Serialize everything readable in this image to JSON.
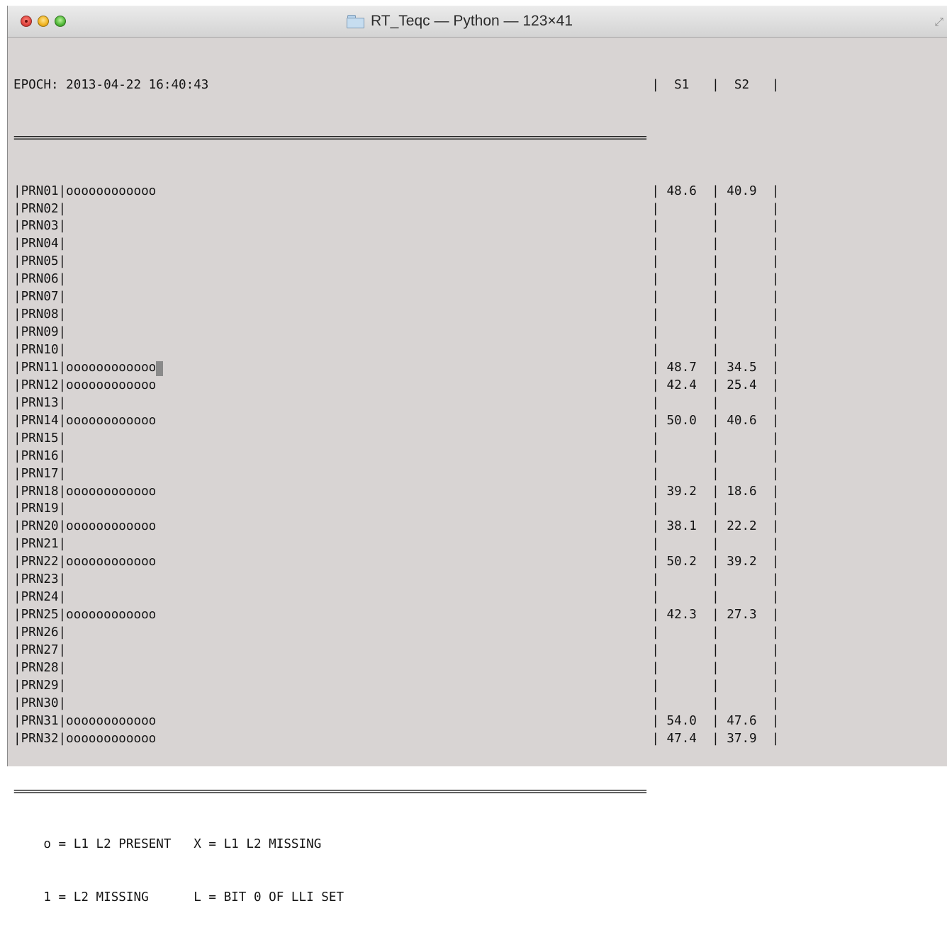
{
  "window": {
    "title": "RT_Teqc — Python — 123×41"
  },
  "terminal": {
    "header": "EPOCH: 2013-04-22 16:40:43                                                           |  S1   |  S2   |",
    "separator": "=========================================================================================================",
    "rows": [
      {
        "prn": "PRN01",
        "obs": "oooooooooooo",
        "s1": "48.6",
        "s2": "40.9"
      },
      {
        "prn": "PRN02",
        "obs": "",
        "s1": "",
        "s2": ""
      },
      {
        "prn": "PRN03",
        "obs": "",
        "s1": "",
        "s2": ""
      },
      {
        "prn": "PRN04",
        "obs": "",
        "s1": "",
        "s2": ""
      },
      {
        "prn": "PRN05",
        "obs": "",
        "s1": "",
        "s2": ""
      },
      {
        "prn": "PRN06",
        "obs": "",
        "s1": "",
        "s2": ""
      },
      {
        "prn": "PRN07",
        "obs": "",
        "s1": "",
        "s2": ""
      },
      {
        "prn": "PRN08",
        "obs": "",
        "s1": "",
        "s2": ""
      },
      {
        "prn": "PRN09",
        "obs": "",
        "s1": "",
        "s2": ""
      },
      {
        "prn": "PRN10",
        "obs": "",
        "s1": "",
        "s2": ""
      },
      {
        "prn": "PRN11",
        "obs": "oooooooooooo",
        "s1": "48.7",
        "s2": "34.5",
        "cursor": true
      },
      {
        "prn": "PRN12",
        "obs": "oooooooooooo",
        "s1": "42.4",
        "s2": "25.4"
      },
      {
        "prn": "PRN13",
        "obs": "",
        "s1": "",
        "s2": ""
      },
      {
        "prn": "PRN14",
        "obs": "oooooooooooo",
        "s1": "50.0",
        "s2": "40.6"
      },
      {
        "prn": "PRN15",
        "obs": "",
        "s1": "",
        "s2": ""
      },
      {
        "prn": "PRN16",
        "obs": "",
        "s1": "",
        "s2": ""
      },
      {
        "prn": "PRN17",
        "obs": "",
        "s1": "",
        "s2": ""
      },
      {
        "prn": "PRN18",
        "obs": "oooooooooooo",
        "s1": "39.2",
        "s2": "18.6"
      },
      {
        "prn": "PRN19",
        "obs": "",
        "s1": "",
        "s2": ""
      },
      {
        "prn": "PRN20",
        "obs": "oooooooooooo",
        "s1": "38.1",
        "s2": "22.2"
      },
      {
        "prn": "PRN21",
        "obs": "",
        "s1": "",
        "s2": ""
      },
      {
        "prn": "PRN22",
        "obs": "oooooooooooo",
        "s1": "50.2",
        "s2": "39.2"
      },
      {
        "prn": "PRN23",
        "obs": "",
        "s1": "",
        "s2": ""
      },
      {
        "prn": "PRN24",
        "obs": "",
        "s1": "",
        "s2": ""
      },
      {
        "prn": "PRN25",
        "obs": "oooooooooooo",
        "s1": "42.3",
        "s2": "27.3"
      },
      {
        "prn": "PRN26",
        "obs": "",
        "s1": "",
        "s2": ""
      },
      {
        "prn": "PRN27",
        "obs": "",
        "s1": "",
        "s2": ""
      },
      {
        "prn": "PRN28",
        "obs": "",
        "s1": "",
        "s2": ""
      },
      {
        "prn": "PRN29",
        "obs": "",
        "s1": "",
        "s2": ""
      },
      {
        "prn": "PRN30",
        "obs": "",
        "s1": "",
        "s2": ""
      },
      {
        "prn": "PRN31",
        "obs": "oooooooooooo",
        "s1": "54.0",
        "s2": "47.6"
      },
      {
        "prn": "PRN32",
        "obs": "oooooooooooo",
        "s1": "47.4",
        "s2": "37.9"
      }
    ],
    "legend": [
      "    o = L1 L2 PRESENT   X = L1 L2 MISSING",
      "    1 = L2 MISSING      L = BIT 0 OF LLI SET"
    ]
  }
}
